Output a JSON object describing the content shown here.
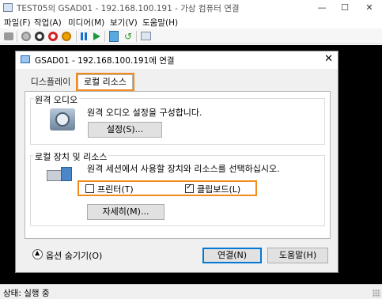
{
  "window": {
    "title": "TEST05의 GSAD01 - 192.168.100.191 - 가상 컴퓨터 연결",
    "minimize": "—",
    "maximize": "☐",
    "close": "✕"
  },
  "menu": [
    "파일(F)",
    "작업(A)",
    "미디어(M)",
    "보기(V)",
    "도움말(H)"
  ],
  "toolbar": {
    "icons": [
      "ctrl-alt-del-icon",
      "start-icon",
      "turn-off-icon",
      "shutdown-icon",
      "power-icon",
      "pause-icon",
      "reset-icon",
      "checkpoint-icon",
      "revert-icon",
      "enhanced-session-icon"
    ]
  },
  "dialog": {
    "title": "GSAD01 - 192.168.100.191에 연결",
    "close": "✕",
    "tabs": {
      "display": "디스플레이",
      "local": "로컬 리소스"
    },
    "audio": {
      "group_label": "원격 오디오",
      "description": "원격 오디오 설정을 구성합니다.",
      "settings_button": "설정(S)..."
    },
    "devices": {
      "group_label": "로컬 장치 및 리소스",
      "description": "원격 세션에서 사용할 장치와 리소스를 선택하십시오.",
      "printer_label": "프린터(T)",
      "printer_checked": false,
      "clipboard_label": "클립보드(L)",
      "clipboard_checked": true,
      "more_button": "자세히(M)..."
    },
    "hide_options": "옵션 숨기기(O)",
    "connect_button": "연결(N)",
    "help_button": "도움말(H)"
  },
  "status": {
    "text": "상태: 실행 중"
  },
  "colors": {
    "highlight": "#f28a1e",
    "accent": "#0078d7"
  }
}
